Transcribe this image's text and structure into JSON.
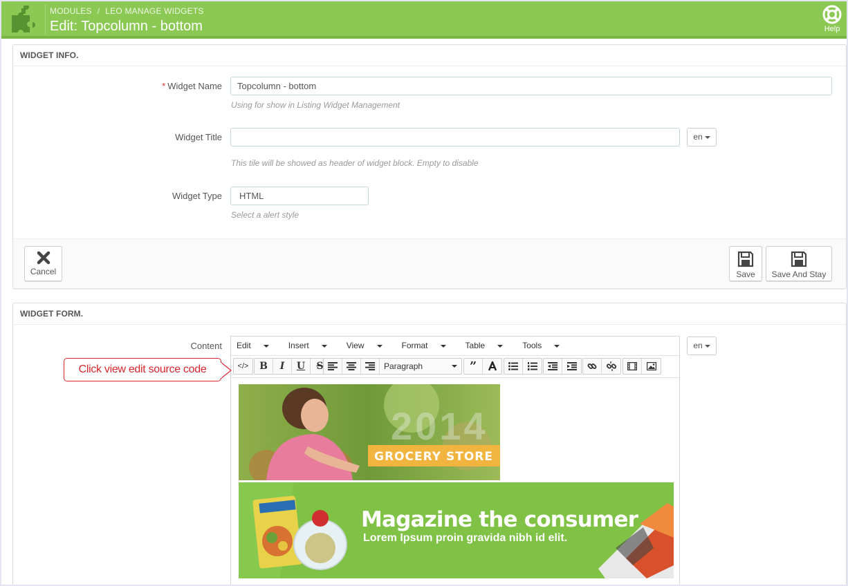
{
  "header": {
    "breadcrumb": [
      "MODULES",
      "LEO MANAGE WIDGETS"
    ],
    "title": "Edit: Topcolumn - bottom",
    "help_label": "Help"
  },
  "widget_info": {
    "heading": "WIDGET INFO.",
    "name_label": "Widget Name",
    "name_value": "Topcolumn - bottom",
    "name_help": "Using for show in Listing Widget Management",
    "title_label": "Widget Title",
    "title_value": "",
    "title_lang": "en",
    "title_help": "This tile will be showed as header of widget block. Empty to disable",
    "type_label": "Widget Type",
    "type_value": "HTML",
    "type_help": "Select a alert style",
    "cancel_label": "Cancel",
    "save_label": "Save",
    "save_stay_label": "Save And Stay"
  },
  "widget_form": {
    "heading": "WIDGET FORM.",
    "content_label": "Content",
    "content_lang": "en",
    "menu": [
      "Edit",
      "Insert",
      "View",
      "Format",
      "Table",
      "Tools"
    ],
    "block_format": "Paragraph",
    "toolbar_icons": [
      "source-code-icon",
      "bold-icon",
      "italic-icon",
      "underline-icon",
      "strikethrough-icon",
      "align-left-icon",
      "align-center-icon",
      "align-right-icon",
      "blockquote-icon",
      "text-color-icon",
      "bullet-list-icon",
      "numbered-list-icon",
      "outdent-icon",
      "indent-icon",
      "link-icon",
      "unlink-icon",
      "media-icon",
      "image-icon"
    ],
    "banner1": {
      "year": "2014",
      "label": "GROCERY STORE"
    },
    "banner2": {
      "headline": "Magazine the consumer",
      "subline": "Lorem Ipsum proin gravida nibh id elit."
    }
  },
  "callout": {
    "text": "Click view edit source code"
  },
  "colors": {
    "header_green": "#8bc954",
    "callout_red": "#d8262c"
  }
}
